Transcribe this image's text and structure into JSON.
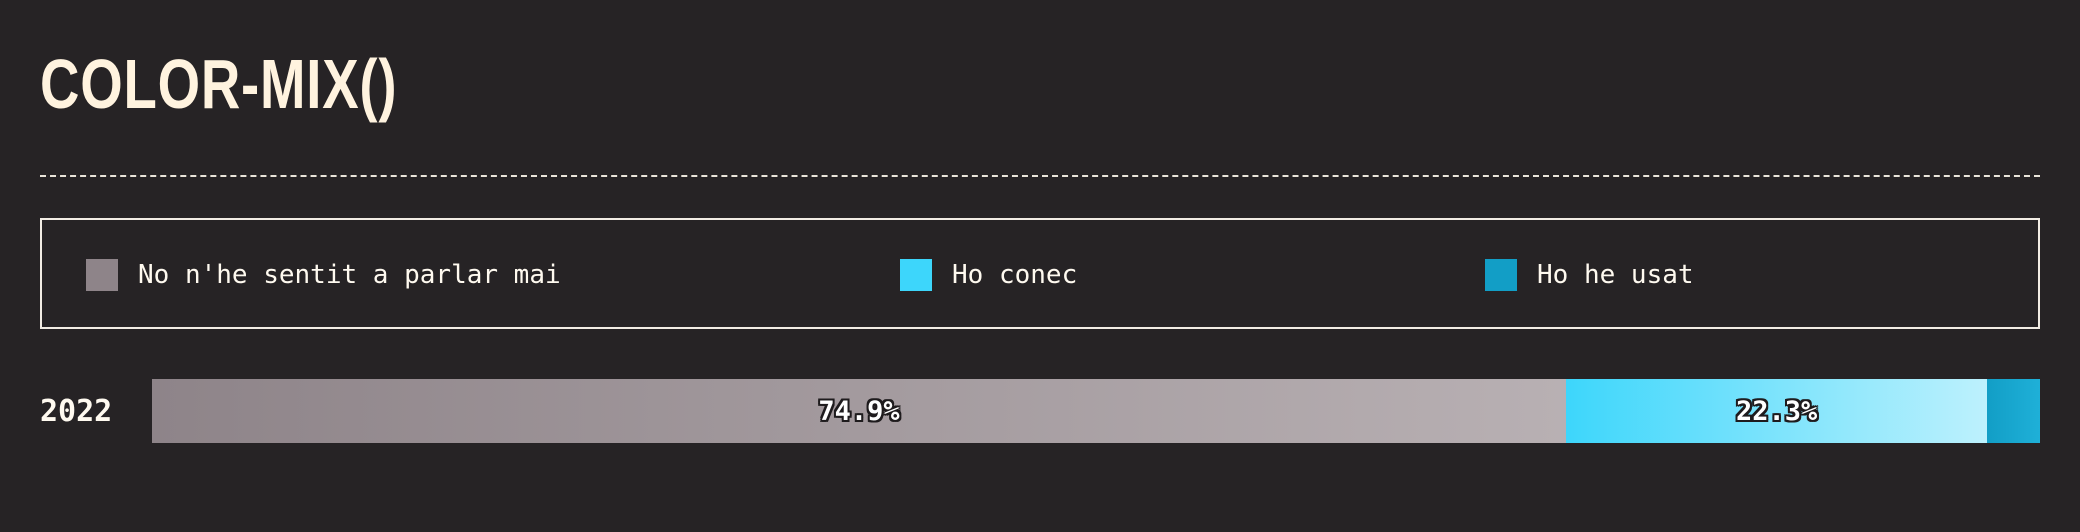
{
  "title": "COLOR-MIX()",
  "chart_data": {
    "type": "bar",
    "orientation": "horizontal",
    "stacked": true,
    "normalized": true,
    "categories": [
      "2022"
    ],
    "series": [
      {
        "name": "No n'he sentit a parlar mai",
        "values": [
          74.9
        ],
        "label": "74.9%",
        "color": "#8e8489",
        "gradient_end": "#b8b0b3"
      },
      {
        "name": "Ho conec",
        "values": [
          22.3
        ],
        "label": "22.3%",
        "color": "#3dd6fb",
        "gradient_end": "#bdf1fd"
      },
      {
        "name": "Ho he usat",
        "values": [
          2.8
        ],
        "label": "",
        "color": "#129ec6",
        "gradient_end": "#1fb0d8"
      }
    ],
    "legend_position": "top",
    "xlim": [
      0,
      100
    ]
  },
  "colors": {
    "background": "#262325",
    "text": "#fffaee"
  }
}
